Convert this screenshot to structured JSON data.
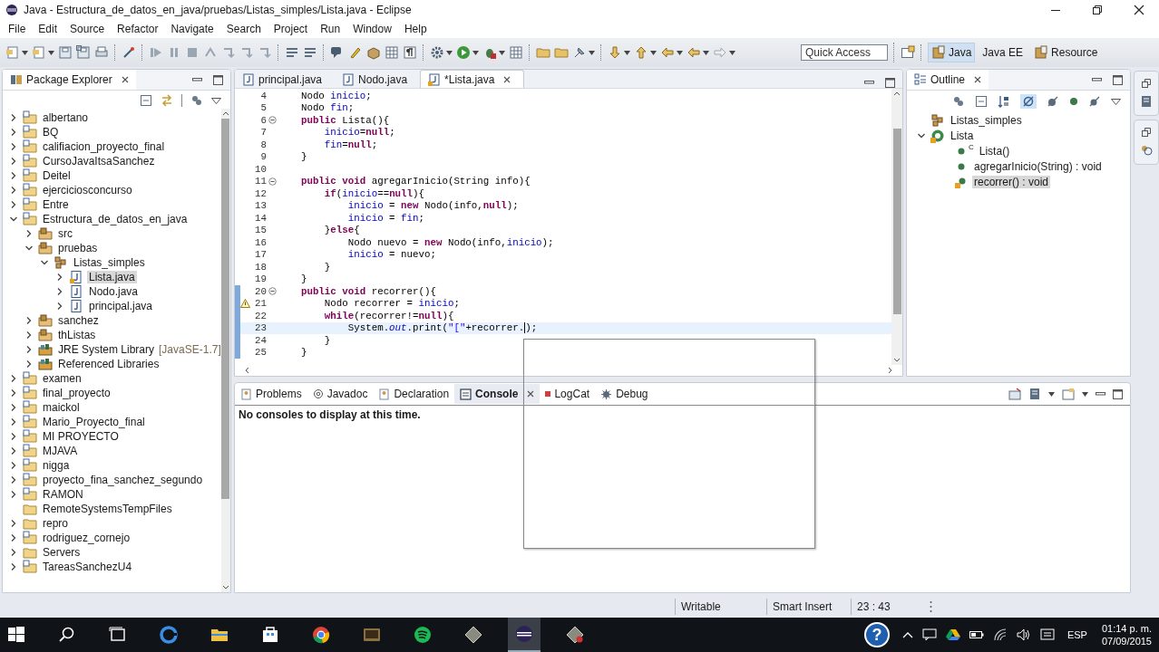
{
  "window": {
    "title": "Java - Estructura_de_datos_en_java/pruebas/Listas_simples/Lista.java - Eclipse"
  },
  "menu": [
    "File",
    "Edit",
    "Source",
    "Refactor",
    "Navigate",
    "Search",
    "Project",
    "Run",
    "Window",
    "Help"
  ],
  "quick_access": {
    "placeholder": "Quick Access"
  },
  "perspectives": [
    {
      "label": "Java",
      "selected": true
    },
    {
      "label": "Java EE",
      "selected": false
    },
    {
      "label": "Resource",
      "selected": false
    }
  ],
  "package_explorer": {
    "title": "Package Explorer",
    "items": [
      {
        "label": "albertano",
        "kind": "project",
        "expanded": false,
        "selected": false
      },
      {
        "label": "BQ",
        "kind": "project",
        "expanded": false,
        "selected": false
      },
      {
        "label": "califiacion_proyecto_final",
        "kind": "project",
        "expanded": false,
        "selected": false
      },
      {
        "label": "CursoJavaItsaSanchez",
        "kind": "project",
        "expanded": false,
        "selected": false
      },
      {
        "label": "Deitel",
        "kind": "project",
        "expanded": false,
        "selected": false
      },
      {
        "label": "ejerciciosconcurso",
        "kind": "project",
        "expanded": false,
        "selected": false
      },
      {
        "label": "Entre",
        "kind": "project",
        "expanded": false,
        "selected": false
      },
      {
        "label": "Estructura_de_datos_en_java",
        "kind": "project",
        "expanded": true,
        "selected": false,
        "children": [
          {
            "label": "src",
            "kind": "source",
            "expanded": false,
            "selected": false
          },
          {
            "label": "pruebas",
            "kind": "source",
            "expanded": true,
            "selected": false,
            "children": [
              {
                "label": "Listas_simples",
                "kind": "package",
                "expanded": true,
                "selected": false,
                "children": [
                  {
                    "label": "Lista.java",
                    "kind": "java",
                    "expanded": false,
                    "selected": true
                  },
                  {
                    "label": "Nodo.java",
                    "kind": "java",
                    "expanded": false,
                    "selected": false
                  },
                  {
                    "label": "principal.java",
                    "kind": "java",
                    "expanded": false,
                    "selected": false
                  }
                ]
              }
            ]
          },
          {
            "label": "sanchez",
            "kind": "source",
            "expanded": false,
            "selected": false
          },
          {
            "label": "thListas",
            "kind": "source",
            "expanded": false,
            "selected": false
          },
          {
            "label": "JRE System Library",
            "suffix": "[JavaSE-1.7]",
            "kind": "library",
            "expanded": false,
            "selected": false
          },
          {
            "label": "Referenced Libraries",
            "kind": "library",
            "expanded": false,
            "selected": false
          }
        ]
      },
      {
        "label": "examen",
        "kind": "project",
        "expanded": false,
        "selected": false
      },
      {
        "label": "final_proyecto",
        "kind": "project",
        "expanded": false,
        "selected": false
      },
      {
        "label": "maickol",
        "kind": "project",
        "expanded": false,
        "selected": false
      },
      {
        "label": "Mario_Proyecto_final",
        "kind": "project",
        "expanded": false,
        "selected": false
      },
      {
        "label": "MI PROYECTO",
        "kind": "project",
        "expanded": false,
        "selected": false
      },
      {
        "label": "MJAVA",
        "kind": "project",
        "expanded": false,
        "selected": false
      },
      {
        "label": "nigga",
        "kind": "project",
        "expanded": false,
        "selected": false
      },
      {
        "label": "proyecto_fina_sanchez_segundo",
        "kind": "project",
        "expanded": false,
        "selected": false
      },
      {
        "label": "RAMON",
        "kind": "project",
        "expanded": false,
        "selected": false
      },
      {
        "label": "RemoteSystemsTempFiles",
        "kind": "folder",
        "selected": false
      },
      {
        "label": "repro",
        "kind": "folder",
        "expanded": false,
        "selected": false
      },
      {
        "label": "rodriguez_cornejo",
        "kind": "project",
        "expanded": false,
        "selected": false
      },
      {
        "label": "Servers",
        "kind": "folder",
        "expanded": false,
        "selected": false
      },
      {
        "label": "TareasSanchezU4",
        "kind": "project",
        "expanded": false,
        "selected": false
      }
    ]
  },
  "editor": {
    "tabs": [
      {
        "label": "principal.java",
        "selected": false
      },
      {
        "label": "Nodo.java",
        "selected": false
      },
      {
        "label": "*Lista.java",
        "selected": true
      }
    ],
    "lines": [
      {
        "number": "4",
        "tokens": [
          {
            "text": "    Nodo ",
            "kind": "plain"
          },
          {
            "text": "inicio",
            "kind": "field"
          },
          {
            "text": ";",
            "kind": "plain"
          }
        ]
      },
      {
        "number": "5",
        "tokens": [
          {
            "text": "    Nodo ",
            "kind": "plain"
          },
          {
            "text": "fin",
            "kind": "field"
          },
          {
            "text": ";",
            "kind": "plain"
          }
        ]
      },
      {
        "number": "6",
        "foldable": true,
        "tokens": [
          {
            "text": "    public",
            "kind": "keyword"
          },
          {
            "text": " Lista(){",
            "kind": "plain"
          }
        ]
      },
      {
        "number": "7",
        "tokens": [
          {
            "text": "        inicio",
            "kind": "field"
          },
          {
            "text": "=",
            "kind": "plain"
          },
          {
            "text": "null",
            "kind": "keyword"
          },
          {
            "text": ";",
            "kind": "plain"
          }
        ]
      },
      {
        "number": "8",
        "tokens": [
          {
            "text": "        fin",
            "kind": "field"
          },
          {
            "text": "=",
            "kind": "plain"
          },
          {
            "text": "null",
            "kind": "keyword"
          },
          {
            "text": ";",
            "kind": "plain"
          }
        ]
      },
      {
        "number": "9",
        "tokens": [
          {
            "text": "    }",
            "kind": "plain"
          }
        ]
      },
      {
        "number": "10"
      },
      {
        "number": "11",
        "foldable": true,
        "tokens": [
          {
            "text": "    public void",
            "kind": "keyword"
          },
          {
            "text": " agregarInicio(String info){",
            "kind": "plain"
          }
        ]
      },
      {
        "number": "12",
        "tokens": [
          {
            "text": "        if",
            "kind": "keyword"
          },
          {
            "text": "(",
            "kind": "plain"
          },
          {
            "text": "inicio",
            "kind": "field"
          },
          {
            "text": "==",
            "kind": "plain"
          },
          {
            "text": "null",
            "kind": "keyword"
          },
          {
            "text": "){",
            "kind": "plain"
          }
        ]
      },
      {
        "number": "13",
        "tokens": [
          {
            "text": "            inicio",
            "kind": "field"
          },
          {
            "text": " = ",
            "kind": "plain"
          },
          {
            "text": "new",
            "kind": "keyword"
          },
          {
            "text": " Nodo(info,",
            "kind": "plain"
          },
          {
            "text": "null",
            "kind": "keyword"
          },
          {
            "text": ");",
            "kind": "plain"
          }
        ]
      },
      {
        "number": "14",
        "tokens": [
          {
            "text": "            inicio",
            "kind": "field"
          },
          {
            "text": " = ",
            "kind": "plain"
          },
          {
            "text": "fin",
            "kind": "field"
          },
          {
            "text": ";",
            "kind": "plain"
          }
        ]
      },
      {
        "number": "15",
        "tokens": [
          {
            "text": "        }",
            "kind": "plain"
          },
          {
            "text": "else",
            "kind": "keyword"
          },
          {
            "text": "{",
            "kind": "plain"
          }
        ]
      },
      {
        "number": "16",
        "tokens": [
          {
            "text": "            Nodo nuevo = ",
            "kind": "plain"
          },
          {
            "text": "new",
            "kind": "keyword"
          },
          {
            "text": " Nodo(info,",
            "kind": "plain"
          },
          {
            "text": "inicio",
            "kind": "field"
          },
          {
            "text": ");",
            "kind": "plain"
          }
        ]
      },
      {
        "number": "17",
        "tokens": [
          {
            "text": "            inicio",
            "kind": "field"
          },
          {
            "text": " = nuevo;",
            "kind": "plain"
          }
        ]
      },
      {
        "number": "18",
        "tokens": [
          {
            "text": "        }",
            "kind": "plain"
          }
        ]
      },
      {
        "number": "19",
        "tokens": [
          {
            "text": "    }",
            "kind": "plain"
          }
        ]
      },
      {
        "number": "20",
        "foldable": true,
        "changed": true,
        "tokens": [
          {
            "text": "    public void",
            "kind": "keyword"
          },
          {
            "text": " recorrer(){",
            "kind": "plain"
          }
        ]
      },
      {
        "number": "21",
        "changed": true,
        "warning": true,
        "tokens": [
          {
            "text": "        Nodo recorrer = ",
            "kind": "plain"
          },
          {
            "text": "inicio",
            "kind": "field"
          },
          {
            "text": ";",
            "kind": "plain"
          }
        ]
      },
      {
        "number": "22",
        "changed": true,
        "tokens": [
          {
            "text": "        while",
            "kind": "keyword"
          },
          {
            "text": "(recorrer!=",
            "kind": "plain"
          },
          {
            "text": "null",
            "kind": "keyword"
          },
          {
            "text": "){",
            "kind": "plain"
          }
        ]
      },
      {
        "number": "23",
        "changed": true,
        "current": true,
        "tokens": [
          {
            "text": "            System.",
            "kind": "plain"
          },
          {
            "text": "out",
            "kind": "static"
          },
          {
            "text": ".print(",
            "kind": "plain"
          },
          {
            "text": "\"[\"",
            "kind": "string"
          },
          {
            "text": "+recorrer.",
            "kind": "plain",
            "caret_after": true
          },
          {
            "text": ");",
            "kind": "plain"
          }
        ]
      },
      {
        "number": "24",
        "changed": true,
        "tokens": [
          {
            "text": "        }",
            "kind": "plain"
          }
        ]
      },
      {
        "number": "25",
        "changed": true,
        "tokens": [
          {
            "text": "    }",
            "kind": "plain"
          }
        ]
      }
    ]
  },
  "completion_popup": {
    "open": true
  },
  "outline": {
    "title": "Outline",
    "items": [
      {
        "label": "Listas_simples",
        "kind": "package",
        "selected": false
      },
      {
        "label": "Lista",
        "kind": "class",
        "expanded": true,
        "selected": false,
        "children": [
          {
            "label": "Lista()",
            "badge": "C",
            "kind": "constructor",
            "selected": false
          },
          {
            "label": "agregarInicio(String) : void",
            "kind": "method",
            "selected": false
          },
          {
            "label": "recorrer() : void",
            "kind": "method-warning",
            "selected": true
          }
        ]
      }
    ]
  },
  "bottom_panel": {
    "tabs": [
      {
        "label": "Problems",
        "kind": "problems",
        "selected": false
      },
      {
        "label": "Javadoc",
        "kind": "javadoc",
        "selected": false
      },
      {
        "label": "Declaration",
        "kind": "declaration",
        "selected": false
      },
      {
        "label": "Console",
        "kind": "console",
        "selected": true
      },
      {
        "label": "LogCat",
        "kind": "logcat",
        "selected": false
      },
      {
        "label": "Debug",
        "kind": "debug",
        "selected": false
      }
    ],
    "message": "No consoles to display at this time."
  },
  "status_bar": {
    "mode": "Writable",
    "insert": "Smart Insert",
    "position": "23 : 43"
  },
  "taskbar": {
    "apps": [
      {
        "kind": "start",
        "active": false
      },
      {
        "kind": "search",
        "active": false
      },
      {
        "kind": "task-view",
        "active": false
      },
      {
        "kind": "browser",
        "active": false
      },
      {
        "kind": "folder",
        "active": false
      },
      {
        "kind": "store",
        "active": false
      },
      {
        "kind": "chrome",
        "active": false
      },
      {
        "kind": "app",
        "active": false
      },
      {
        "kind": "music",
        "active": false
      },
      {
        "kind": "diamond",
        "active": false
      },
      {
        "kind": "eclipse",
        "active": true
      },
      {
        "kind": "diamond-red",
        "active": false
      }
    ],
    "help": "?",
    "language": "ESP",
    "time": "01:14 p. m.",
    "date": "07/09/2015"
  }
}
